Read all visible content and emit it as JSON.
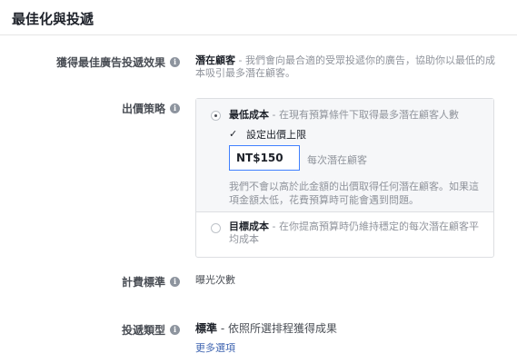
{
  "section": {
    "title": "最佳化與投遞"
  },
  "optimization": {
    "label": "獲得最佳廣告投遞效果",
    "value": "潛在顧客",
    "description": " - 我們會向最合適的受眾投遞你的廣告，協助你以最低的成本吸引最多潛在顧客。"
  },
  "bid_strategy": {
    "label": "出價策略",
    "option_lowest": {
      "title": "最低成本",
      "description": " - 在現有預算條件下取得最多潛在顧客人數",
      "selected": true
    },
    "cap_checkbox_label": "設定出價上限",
    "cap_checkbox_mark": "✓",
    "amount_value": "NT$150",
    "per_label": "每次潛在顧客",
    "warning": "我們不會以高於此金額的出價取得任何潛在顧客。如果這項金額太低，花費預算時可能會遇到問題。",
    "option_target": {
      "title": "目標成本",
      "description": " - 在你提高預算時仍維持穩定的每次潛在顧客平均成本",
      "selected": false
    }
  },
  "billing": {
    "label": "計費標準",
    "value": "曝光次數"
  },
  "delivery_type": {
    "label": "投遞類型",
    "value": "標準",
    "description": " - 依照所選排程獲得成果",
    "more_link": "更多選項"
  },
  "icons": {
    "info": "info-icon"
  },
  "colors": {
    "accent": "#4080ff",
    "link": "#4267b2",
    "muted": "#90949c"
  }
}
